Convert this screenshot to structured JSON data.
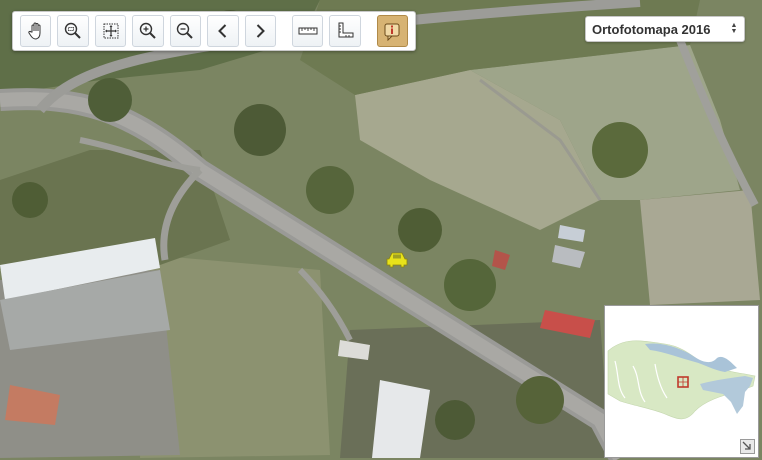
{
  "map": {
    "layer_select": {
      "value": "Ortofotomapa 2016"
    },
    "toolbar": {
      "buttons": [
        {
          "name": "pan-tool-button",
          "icon": "hand-icon"
        },
        {
          "name": "zoom-box-button",
          "icon": "zoom-box-icon"
        },
        {
          "name": "full-extent-button",
          "icon": "full-extent-icon"
        },
        {
          "name": "zoom-in-button",
          "icon": "zoom-in-icon"
        },
        {
          "name": "zoom-out-button",
          "icon": "zoom-out-icon"
        },
        {
          "name": "previous-extent-button",
          "icon": "chevron-left-icon"
        },
        {
          "name": "next-extent-button",
          "icon": "chevron-right-icon"
        },
        {
          "name": "measure-distance-button",
          "icon": "ruler-icon"
        },
        {
          "name": "measure-area-button",
          "icon": "area-ruler-icon"
        },
        {
          "name": "info-tool-button",
          "icon": "info-icon",
          "active": true
        }
      ]
    },
    "colors": {
      "active_tool": "#d7b373",
      "marker": "#e8e21a",
      "overview_highlight": "#c0392b"
    }
  }
}
